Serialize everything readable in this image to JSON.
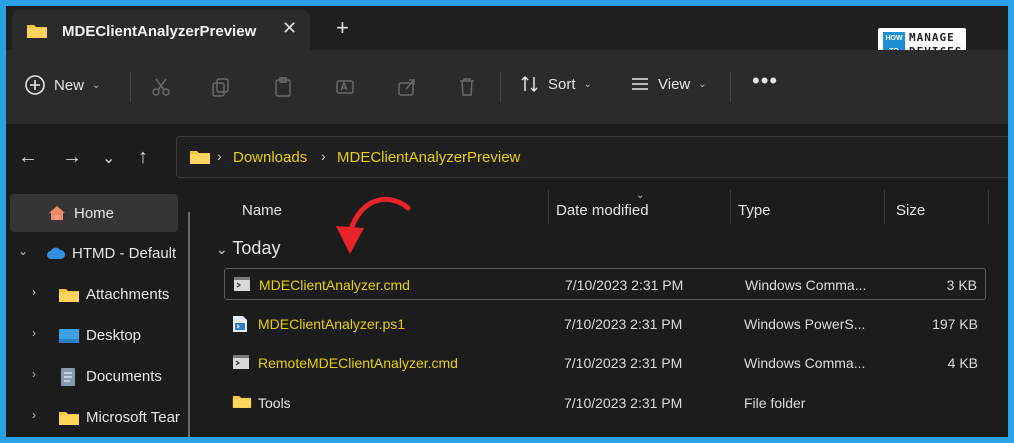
{
  "tab": {
    "title": "MDEClientAnalyzerPreview",
    "close": "✕",
    "new": "+"
  },
  "logo": {
    "how": "HOW",
    "to": "TO",
    "manage": "MANAGE",
    "devices": "DEVICES"
  },
  "toolbar": {
    "new_label": "New",
    "sort_label": "Sort",
    "view_label": "View",
    "more": "•••"
  },
  "address": {
    "crumbs": [
      "Downloads",
      "MDEClientAnalyzerPreview"
    ],
    "sep": "›"
  },
  "sidebar": {
    "items": [
      {
        "label": "Home",
        "icon": "home-icon"
      },
      {
        "label": "HTMD - Default",
        "icon": "cloud-icon"
      },
      {
        "label": "Attachments",
        "icon": "folder-icon"
      },
      {
        "label": "Desktop",
        "icon": "desktop-icon"
      },
      {
        "label": "Documents",
        "icon": "document-icon"
      },
      {
        "label": "Microsoft Tear",
        "icon": "folder-icon"
      }
    ]
  },
  "columns": {
    "name": "Name",
    "date": "Date modified",
    "type": "Type",
    "size": "Size"
  },
  "group": {
    "label": "Today"
  },
  "files": [
    {
      "name": "MDEClientAnalyzer.cmd",
      "date": "7/10/2023 2:31 PM",
      "type": "Windows Comma...",
      "size": "3 KB",
      "icon": "cmd-file-icon"
    },
    {
      "name": "MDEClientAnalyzer.ps1",
      "date": "7/10/2023 2:31 PM",
      "type": "Windows PowerS...",
      "size": "197 KB",
      "icon": "ps1-file-icon"
    },
    {
      "name": "RemoteMDEClientAnalyzer.cmd",
      "date": "7/10/2023 2:31 PM",
      "type": "Windows Comma...",
      "size": "4 KB",
      "icon": "cmd-file-icon"
    },
    {
      "name": "Tools",
      "date": "7/10/2023 2:31 PM",
      "type": "File folder",
      "size": "",
      "icon": "folder-icon"
    }
  ],
  "colors": {
    "highlight": "#e8d000",
    "accent_arrow": "#e8242a",
    "frame": "#2aa0e6"
  }
}
